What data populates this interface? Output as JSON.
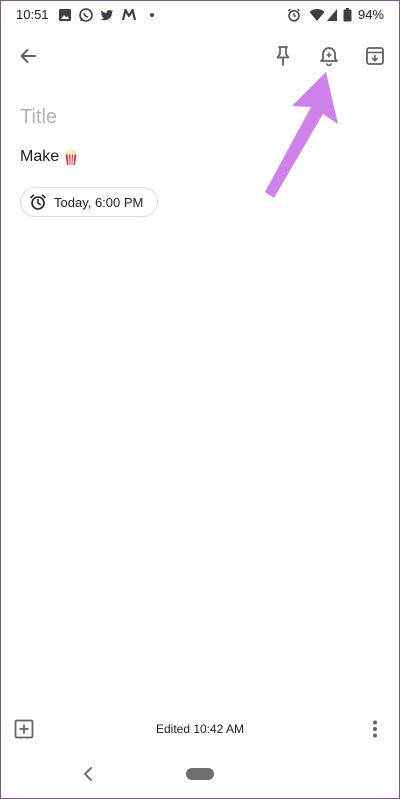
{
  "status_bar": {
    "time": "10:51",
    "battery": "94%",
    "icons": [
      "image-icon",
      "whatsapp-icon",
      "twitter-icon",
      "maps-icon",
      "dot-icon",
      "alarm-icon",
      "wifi-icon",
      "signal-icon",
      "battery-icon"
    ]
  },
  "toolbar": {
    "back_icon": "arrow-back-icon",
    "pin_icon": "pin-icon",
    "reminder_icon": "add-alert-bell-icon",
    "archive_icon": "archive-icon"
  },
  "note": {
    "title_placeholder": "Title",
    "body_text": "Make",
    "body_emoji": "popcorn-icon",
    "reminder_label": "Today, 6:00 PM"
  },
  "bottom_bar": {
    "edited_text": "Edited 10:42 AM"
  },
  "colors": {
    "accent_arrow": "#cf82ec",
    "chip_border": "#dadce0",
    "placeholder": "#b0b3b8",
    "text": "#202124"
  }
}
